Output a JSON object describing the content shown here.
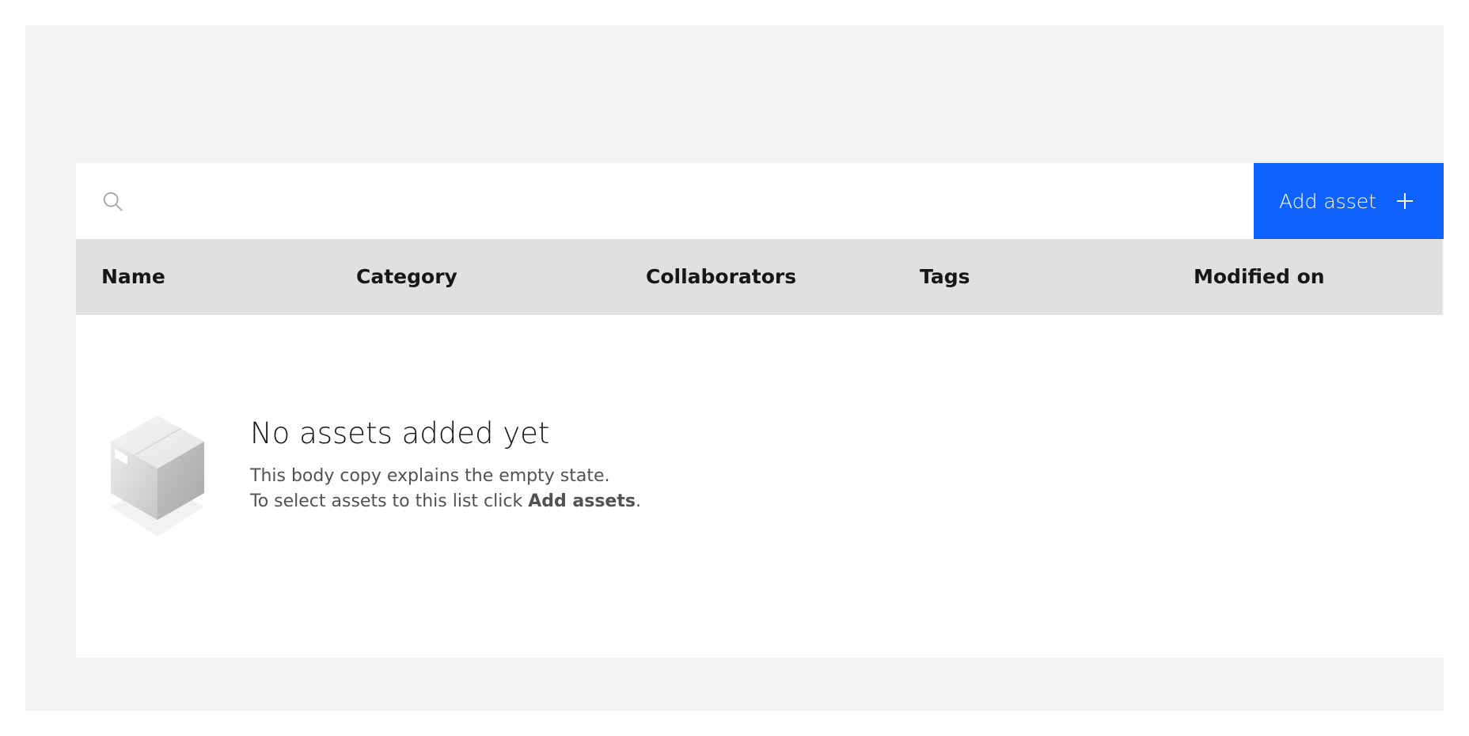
{
  "toolbar": {
    "search_placeholder": "",
    "search_icon": "search-icon",
    "add_button_label": "Add asset",
    "add_button_icon": "plus-icon",
    "accent_color": "#0f62fe"
  },
  "table": {
    "columns": [
      "Name",
      "Category",
      "Collaborators",
      "Tags",
      "Modified on"
    ],
    "header_bg": "#e0e0e0",
    "rows": []
  },
  "empty_state": {
    "illustration": "box-icon",
    "title": "No assets added yet",
    "line1": "This body copy explains the empty state.",
    "line2_prefix": "To select assets to this list click ",
    "line2_bold": "Add assets",
    "line2_suffix": "."
  }
}
